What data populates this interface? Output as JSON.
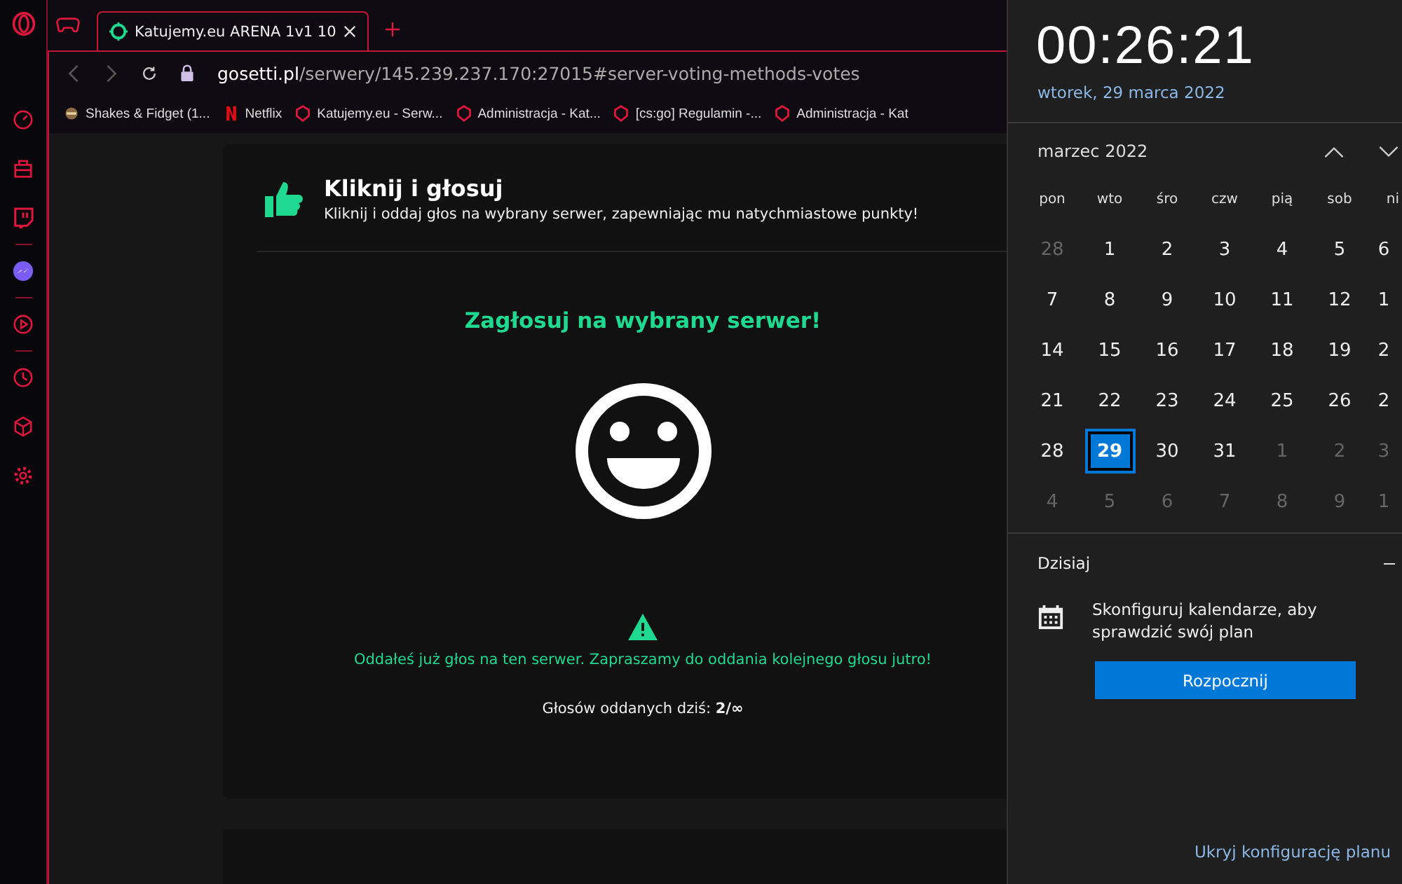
{
  "tabs": [
    {
      "title": "Katujemy.eu ARENA 1v1 10",
      "selected": true
    }
  ],
  "address": {
    "domain": "gosetti.pl",
    "path": "/serwery/145.239.237.170:27015#server-voting-methods-votes"
  },
  "bookmarks": [
    {
      "label": "Shakes & Fidget (1...",
      "kind": "game"
    },
    {
      "label": "Netflix",
      "kind": "netflix"
    },
    {
      "label": "Katujemy.eu - Serw...",
      "kind": "site"
    },
    {
      "label": "Administracja - Kat...",
      "kind": "site"
    },
    {
      "label": "[cs:go] Regulamin -...",
      "kind": "site"
    },
    {
      "label": "Administracja - Kat",
      "kind": "site"
    }
  ],
  "vote": {
    "title": "Kliknij i głosuj",
    "subtitle": "Kliknij i oddaj głos na wybrany serwer, zapewniając mu natychmiastowe punkty!",
    "heading": "Zagłosuj na wybrany serwer!",
    "notice": "Oddałeś już głos na ten serwer. Zapraszamy do oddania kolejnego głosu jutro!",
    "count_label": "Głosów oddanych dziś: **2/∞**"
  },
  "clock": {
    "time": "00:26:21",
    "date": "wtorek, 29 marca 2022"
  },
  "calendar": {
    "month": "marzec 2022",
    "weekdays": [
      "pon",
      "wto",
      "śro",
      "czw",
      "pią",
      "sob",
      "ni"
    ],
    "weeks": [
      [
        {
          "day": "28",
          "muted": true,
          "selected": false
        },
        {
          "day": "1",
          "muted": false,
          "selected": false
        },
        {
          "day": "2",
          "muted": false,
          "selected": false
        },
        {
          "day": "3",
          "muted": false,
          "selected": false
        },
        {
          "day": "4",
          "muted": false,
          "selected": false
        },
        {
          "day": "5",
          "muted": false,
          "selected": false
        },
        {
          "day": "6",
          "muted": false,
          "selected": false
        }
      ],
      [
        {
          "day": "7",
          "muted": false,
          "selected": false
        },
        {
          "day": "8",
          "muted": false,
          "selected": false
        },
        {
          "day": "9",
          "muted": false,
          "selected": false
        },
        {
          "day": "10",
          "muted": false,
          "selected": false
        },
        {
          "day": "11",
          "muted": false,
          "selected": false
        },
        {
          "day": "12",
          "muted": false,
          "selected": false
        },
        {
          "day": "1",
          "muted": false,
          "selected": false
        }
      ],
      [
        {
          "day": "14",
          "muted": false,
          "selected": false
        },
        {
          "day": "15",
          "muted": false,
          "selected": false
        },
        {
          "day": "16",
          "muted": false,
          "selected": false
        },
        {
          "day": "17",
          "muted": false,
          "selected": false
        },
        {
          "day": "18",
          "muted": false,
          "selected": false
        },
        {
          "day": "19",
          "muted": false,
          "selected": false
        },
        {
          "day": "2",
          "muted": false,
          "selected": false
        }
      ],
      [
        {
          "day": "21",
          "muted": false,
          "selected": false
        },
        {
          "day": "22",
          "muted": false,
          "selected": false
        },
        {
          "day": "23",
          "muted": false,
          "selected": false
        },
        {
          "day": "24",
          "muted": false,
          "selected": false
        },
        {
          "day": "25",
          "muted": false,
          "selected": false
        },
        {
          "day": "26",
          "muted": false,
          "selected": false
        },
        {
          "day": "2",
          "muted": false,
          "selected": false
        }
      ],
      [
        {
          "day": "28",
          "muted": false,
          "selected": false
        },
        {
          "day": "29",
          "muted": false,
          "selected": true
        },
        {
          "day": "30",
          "muted": false,
          "selected": false
        },
        {
          "day": "31",
          "muted": false,
          "selected": false
        },
        {
          "day": "1",
          "muted": true,
          "selected": false
        },
        {
          "day": "2",
          "muted": true,
          "selected": false
        },
        {
          "day": "3",
          "muted": true,
          "selected": false
        }
      ],
      [
        {
          "day": "4",
          "muted": true,
          "selected": false
        },
        {
          "day": "5",
          "muted": true,
          "selected": false
        },
        {
          "day": "6",
          "muted": true,
          "selected": false
        },
        {
          "day": "7",
          "muted": true,
          "selected": false
        },
        {
          "day": "8",
          "muted": true,
          "selected": false
        },
        {
          "day": "9",
          "muted": true,
          "selected": false
        },
        {
          "day": "1",
          "muted": true,
          "selected": false
        }
      ]
    ]
  },
  "agenda": {
    "title": "Dzisiaj",
    "message": "Skonfiguruj kalendarze, aby sprawdzić swój plan",
    "button": "Rozpocznij",
    "link": "Ukryj konfigurację planu"
  }
}
